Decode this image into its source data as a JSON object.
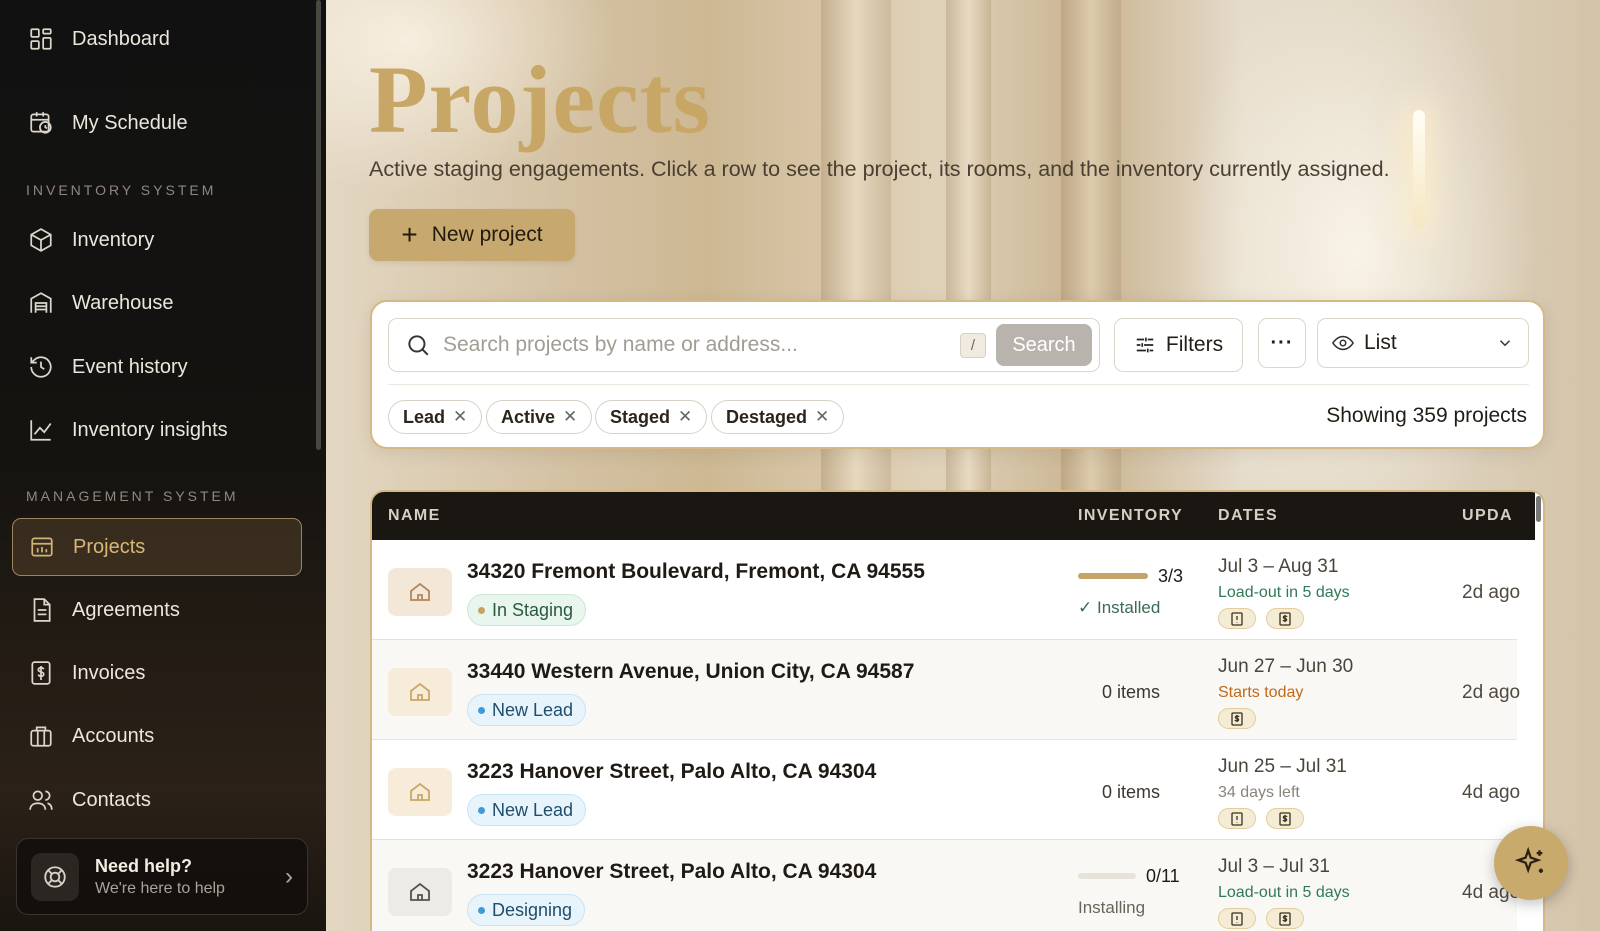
{
  "sidebar": {
    "items_top": [
      {
        "label": "Dashboard",
        "icon": "grid-icon"
      },
      {
        "label": "My Schedule",
        "icon": "calendar-clock-icon"
      }
    ],
    "inventory_section": "INVENTORY SYSTEM",
    "inventory_items": [
      {
        "label": "Inventory",
        "icon": "box-icon"
      },
      {
        "label": "Warehouse",
        "icon": "warehouse-icon"
      },
      {
        "label": "Event history",
        "icon": "history-icon"
      },
      {
        "label": "Inventory insights",
        "icon": "line-chart-icon"
      }
    ],
    "management_section": "MANAGEMENT SYSTEM",
    "management_items": [
      {
        "label": "Projects",
        "icon": "projects-icon",
        "active": true
      },
      {
        "label": "Agreements",
        "icon": "document-icon"
      },
      {
        "label": "Invoices",
        "icon": "invoice-icon"
      },
      {
        "label": "Accounts",
        "icon": "building-icon"
      },
      {
        "label": "Contacts",
        "icon": "users-icon"
      }
    ],
    "help": {
      "title": "Need help?",
      "subtitle": "We're here to help"
    }
  },
  "header": {
    "title": "Projects",
    "subtitle": "Active staging engagements. Click a row to see the project, its rooms, and the inventory currently assigned.",
    "new_button": "New project"
  },
  "toolbar": {
    "search_placeholder": "Search projects by name or address...",
    "shortcut": "/",
    "search_button": "Search",
    "filters_button": "Filters",
    "more_button": "···",
    "view_select": "List",
    "chips": [
      "Lead",
      "Active",
      "Staged",
      "Destaged"
    ],
    "showing": "Showing 359 projects"
  },
  "table": {
    "columns": [
      "NAME",
      "INVENTORY",
      "DATES",
      "UPDA"
    ],
    "rows": [
      {
        "address": "34320 Fremont Boulevard, Fremont, CA 94555",
        "status": "In Staging",
        "inventory_count": "3/3",
        "inventory_progress": 1.0,
        "inventory_note": "✓ Installed",
        "dates": "Jul 3 – Aug 31",
        "date_note": "Load-out in 5 days",
        "updated": "2d ago"
      },
      {
        "address": "33440 Western Avenue, Union City, CA 94587",
        "status": "New Lead",
        "inventory_items": "0 items",
        "dates": "Jun 27 – Jun 30",
        "date_note": "Starts today",
        "updated": "2d ago"
      },
      {
        "address": "3223 Hanover Street, Palo Alto, CA 94304",
        "status": "New Lead",
        "inventory_items": "0 items",
        "dates": "Jun 25 – Jul 31",
        "date_note": "34 days left",
        "updated": "4d ago"
      },
      {
        "address": "3223 Hanover Street, Palo Alto, CA 94304",
        "status": "Designing",
        "inventory_count": "0/11",
        "inventory_progress": 0.0,
        "inventory_note": "Installing",
        "dates": "Jul 3 – Jul 31",
        "date_note": "Load-out in 5 days",
        "updated": "4d ago"
      }
    ]
  },
  "colors": {
    "accent": "#c7a96f",
    "sidebar_bg": "#121110",
    "status_staging": "#e8f5ec",
    "status_lead": "#e6f3fb"
  }
}
